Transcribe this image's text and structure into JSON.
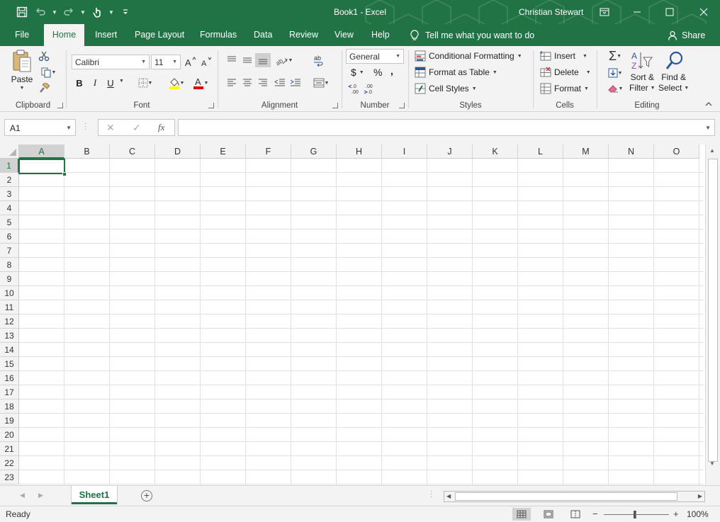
{
  "window": {
    "title": "Book1  -  Excel",
    "user": "Christian Stewart"
  },
  "tabs": [
    "File",
    "Home",
    "Insert",
    "Page Layout",
    "Formulas",
    "Data",
    "Review",
    "View",
    "Help"
  ],
  "active_tab": "Home",
  "tell_me": "Tell me what you want to do",
  "share": "Share",
  "ribbon": {
    "clipboard": {
      "paste": "Paste",
      "label": "Clipboard"
    },
    "font": {
      "name": "Calibri",
      "size": "11",
      "label": "Font",
      "bold": "B",
      "italic": "I",
      "underline": "U"
    },
    "alignment": {
      "label": "Alignment"
    },
    "number": {
      "format": "General",
      "currency": "$",
      "percent": "%",
      "comma": ",",
      "label": "Number"
    },
    "styles": {
      "conditional": "Conditional Formatting",
      "format_table": "Format as Table",
      "cell_styles": "Cell Styles",
      "label": "Styles"
    },
    "cells": {
      "insert": "Insert",
      "delete": "Delete",
      "format": "Format",
      "label": "Cells"
    },
    "editing": {
      "sort_line1": "Sort &",
      "sort_line2": "Filter",
      "find_line1": "Find &",
      "find_line2": "Select",
      "label": "Editing"
    }
  },
  "formula_bar": {
    "name_box": "A1",
    "fx": "fx",
    "value": ""
  },
  "columns": [
    "A",
    "B",
    "C",
    "D",
    "E",
    "F",
    "G",
    "H",
    "I",
    "J",
    "K",
    "L",
    "M",
    "N",
    "O"
  ],
  "rows": [
    "1",
    "2",
    "3",
    "4",
    "5",
    "6",
    "7",
    "8",
    "9",
    "10",
    "11",
    "12",
    "13",
    "14",
    "15",
    "16",
    "17",
    "18",
    "19",
    "20",
    "21",
    "22",
    "23"
  ],
  "selected_cell": "A1",
  "sheet_tabs": [
    "Sheet1"
  ],
  "status": {
    "text": "Ready",
    "zoom": "100%"
  },
  "colors": {
    "brand": "#217346",
    "ribbon_bg": "#f3f3f3",
    "grid_line": "#e1e1e1"
  }
}
